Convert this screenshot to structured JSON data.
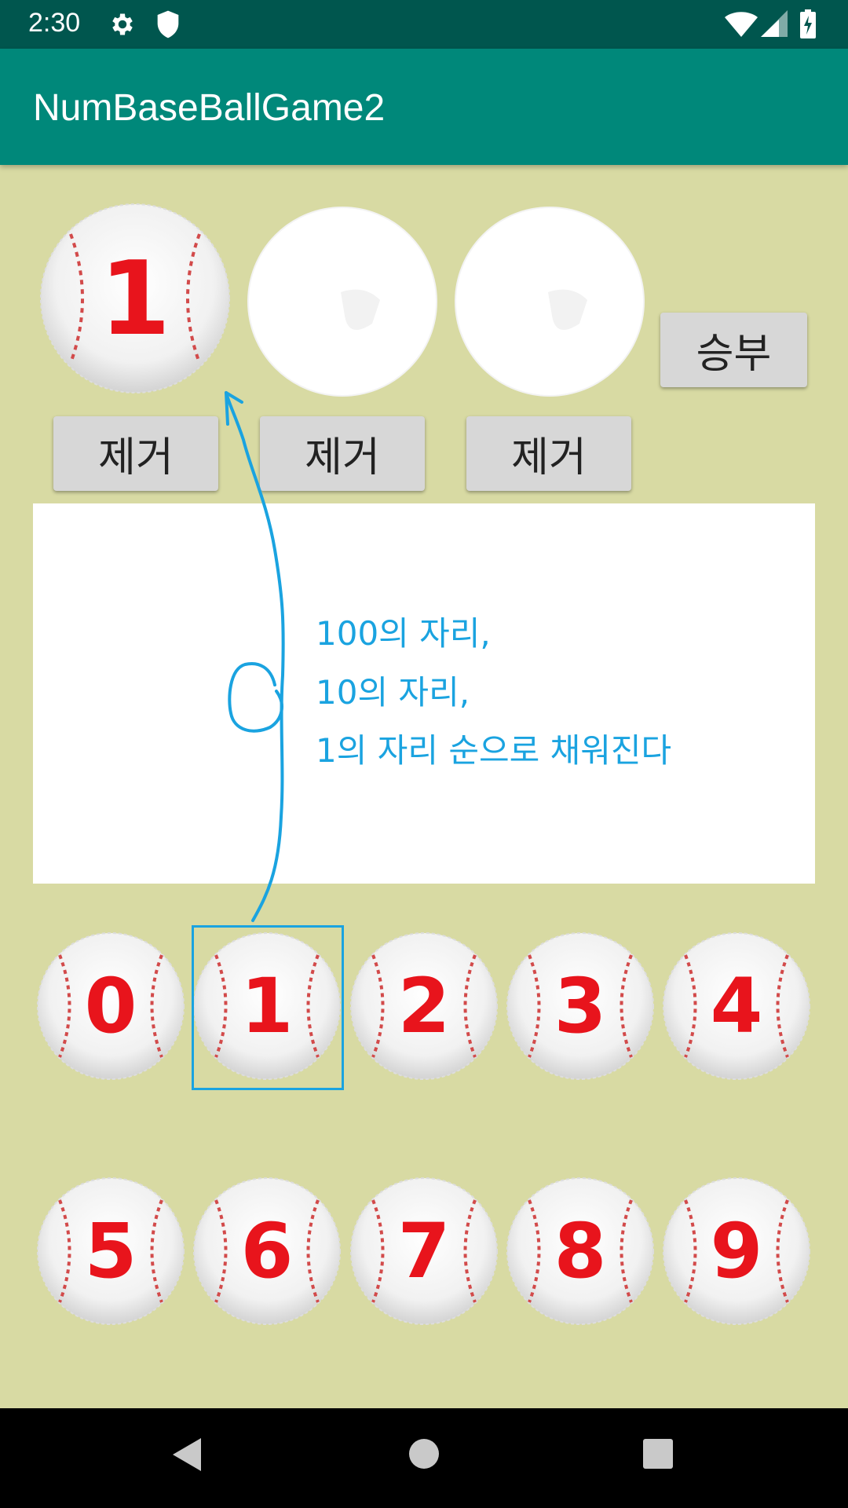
{
  "status_bar": {
    "time": "2:30",
    "icons": [
      "gear-icon",
      "shield-icon",
      "wifi-icon",
      "cell-signal-icon",
      "battery-charging-icon"
    ]
  },
  "app_bar": {
    "title": "NumBaseBallGame2"
  },
  "slots": [
    {
      "value": "1"
    },
    {
      "value": ""
    },
    {
      "value": ""
    }
  ],
  "buttons": {
    "submit_label": "승부",
    "remove_label": "제거"
  },
  "annotation": {
    "lines": [
      "100의 자리,",
      "10의 자리,",
      "1의 자리 순으로 채워진다"
    ],
    "color": "#1aa3e0"
  },
  "digit_balls": [
    "0",
    "1",
    "2",
    "3",
    "4",
    "5",
    "6",
    "7",
    "8",
    "9"
  ],
  "colors": {
    "status_bar": "#00564e",
    "app_bar": "#00887a",
    "background": "#d8daa3",
    "digit": "#e8141c"
  },
  "nav_bar": {
    "icons": [
      "back-icon",
      "home-icon",
      "recents-icon"
    ]
  }
}
